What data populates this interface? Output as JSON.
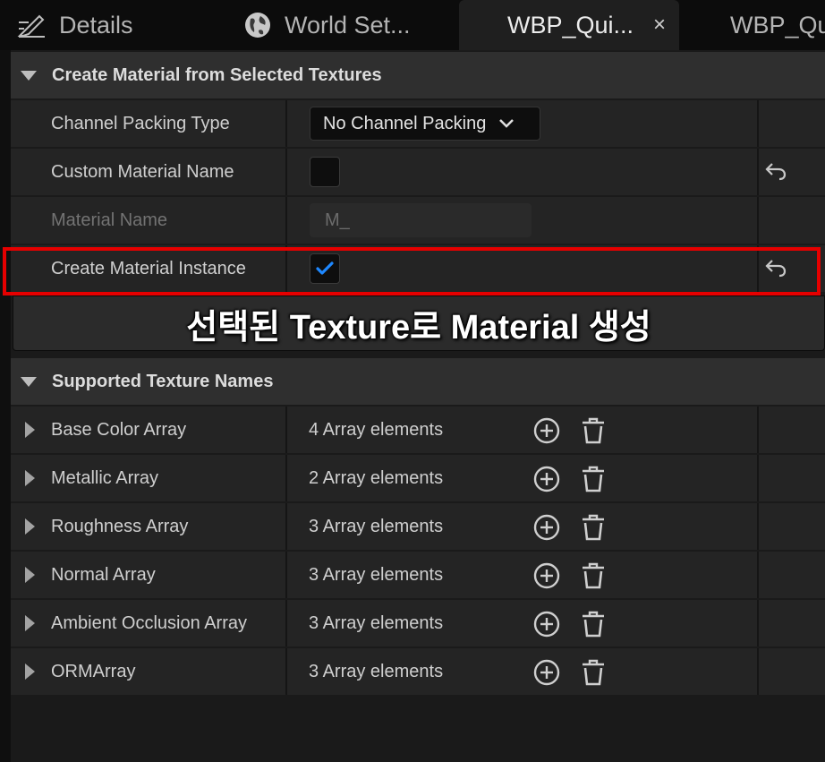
{
  "tabs": [
    {
      "label": "Details",
      "icon": "pencil-icon"
    },
    {
      "label": "World Set...",
      "icon": "globe-icon"
    },
    {
      "label": "WBP_Qui...",
      "icon": "",
      "active": true,
      "close": "×"
    },
    {
      "label": "WBP_Qu",
      "icon": ""
    }
  ],
  "create_section": {
    "title": "Create Material from Selected Textures",
    "rows": [
      {
        "label": "Channel Packing Type",
        "value": "No Channel Packing"
      },
      {
        "label": "Custom Material Name",
        "checked": false
      },
      {
        "label": "Material Name",
        "placeholder": "M_"
      },
      {
        "label": "Create Material Instance",
        "checked": true
      }
    ]
  },
  "tooltip": "선택된 Texture로 Material 생성",
  "supported_section": {
    "title": "Supported Texture Names",
    "rows": [
      {
        "label": "Base Color Array",
        "value": "4 Array elements"
      },
      {
        "label": "Metallic Array",
        "value": "2 Array elements"
      },
      {
        "label": "Roughness Array",
        "value": "3 Array elements"
      },
      {
        "label": "Normal Array",
        "value": "3 Array elements"
      },
      {
        "label": "Ambient Occlusion Array",
        "value": "3 Array elements"
      },
      {
        "label": "ORMArray",
        "value": "3 Array elements"
      }
    ]
  },
  "colors": {
    "highlight": "#e60000",
    "check": "#1e88ff"
  }
}
